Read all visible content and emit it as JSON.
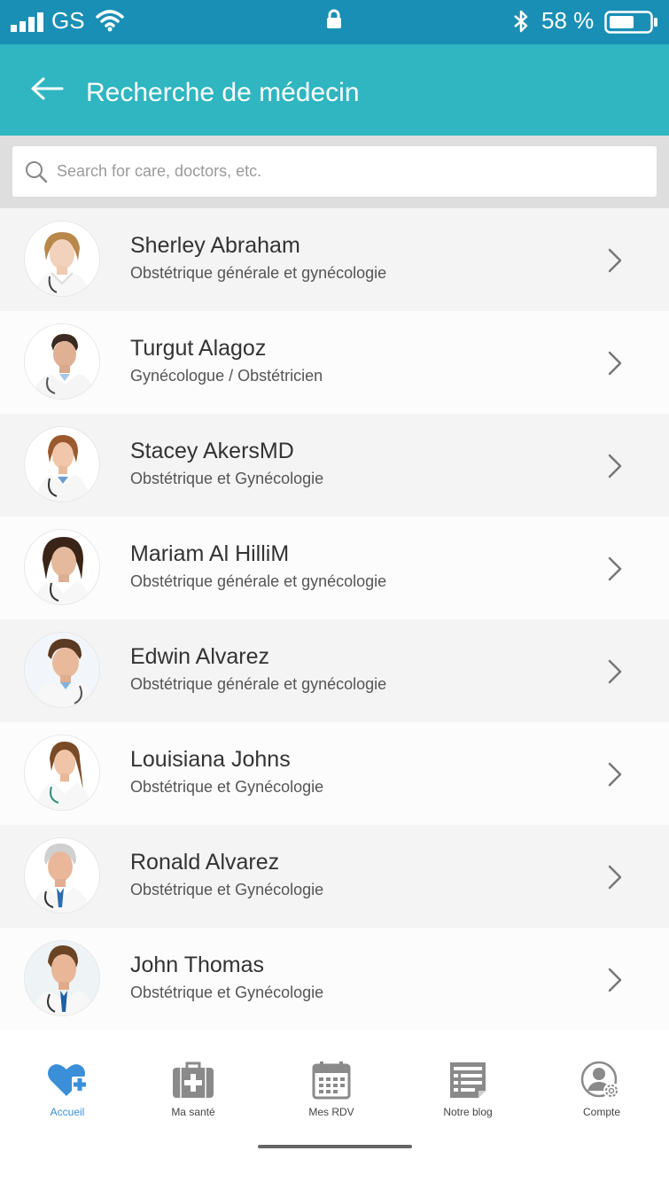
{
  "status_bar": {
    "carrier": "GS",
    "battery_percent": "58 %"
  },
  "header": {
    "title": "Recherche de médecin"
  },
  "search": {
    "placeholder": "Search for care, doctors, etc."
  },
  "doctors": [
    {
      "name": "Sherley Abraham",
      "specialty": "Obstétrique générale et gynécologie"
    },
    {
      "name": "Turgut Alagoz",
      "specialty": "Gynécologue / Obstétricien"
    },
    {
      "name": "Stacey AkersMD",
      "specialty": "Obstétrique et Gynécologie"
    },
    {
      "name": "Mariam Al HilliM",
      "specialty": "Obstétrique générale et gynécologie"
    },
    {
      "name": "Edwin Alvarez",
      "specialty": "Obstétrique générale et gynécologie"
    },
    {
      "name": "Louisiana Johns",
      "specialty": "Obstétrique et Gynécologie"
    },
    {
      "name": "Ronald Alvarez",
      "specialty": "Obstétrique et Gynécologie"
    },
    {
      "name": "John Thomas",
      "specialty": "Obstétrique et Gynécologie"
    }
  ],
  "bottom_nav": [
    {
      "label": "Accueil",
      "icon": "heart-plus-icon",
      "active": true
    },
    {
      "label": "Ma santé",
      "icon": "medical-kit-icon",
      "active": false
    },
    {
      "label": "Mes RDV",
      "icon": "calendar-icon",
      "active": false
    },
    {
      "label": "Notre blog",
      "icon": "blog-icon",
      "active": false
    },
    {
      "label": "Compte",
      "icon": "account-settings-icon",
      "active": false
    }
  ],
  "colors": {
    "status_bar": "#1a8fb5",
    "app_bar": "#2fb6c0",
    "active_nav": "#3a8fd8",
    "inactive_nav": "#8a8a8a"
  }
}
